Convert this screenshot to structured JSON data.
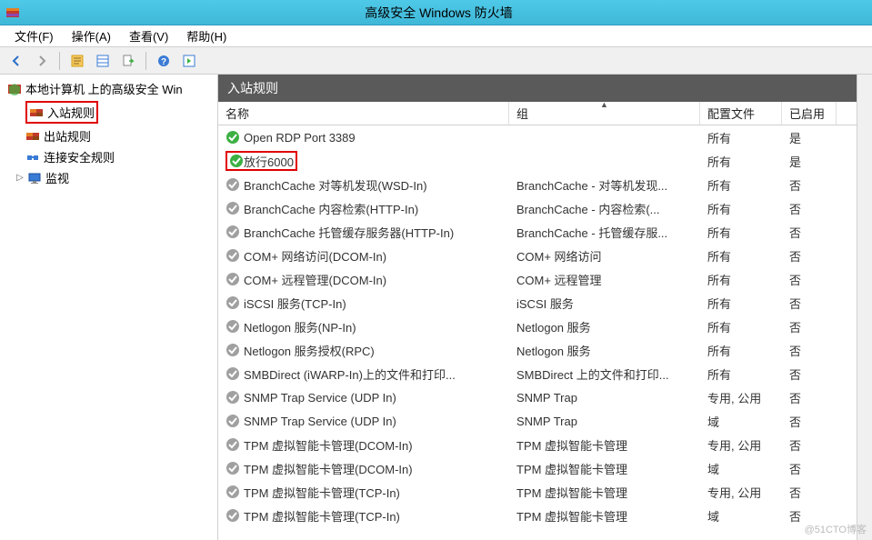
{
  "window": {
    "title": "高级安全 Windows 防火墙"
  },
  "menu": {
    "file": "文件(F)",
    "action": "操作(A)",
    "view": "查看(V)",
    "help": "帮助(H)"
  },
  "tree": {
    "root": "本地计算机 上的高级安全 Win",
    "inbound": "入站规则",
    "outbound": "出站规则",
    "connsec": "连接安全规则",
    "monitor": "监视"
  },
  "list": {
    "header": "入站规则",
    "columns": {
      "name": "名称",
      "group": "组",
      "profile": "配置文件",
      "enabled": "已启用"
    },
    "rows": [
      {
        "name": "Open RDP Port 3389",
        "group": "",
        "profile": "所有",
        "enabled": "是",
        "state": "enabled",
        "highlight": false
      },
      {
        "name": "放行6000",
        "group": "",
        "profile": "所有",
        "enabled": "是",
        "state": "enabled",
        "highlight": true
      },
      {
        "name": "BranchCache 对等机发现(WSD-In)",
        "group": "BranchCache - 对等机发现...",
        "profile": "所有",
        "enabled": "否",
        "state": "disabled",
        "highlight": false
      },
      {
        "name": "BranchCache 内容检索(HTTP-In)",
        "group": "BranchCache - 内容检索(...",
        "profile": "所有",
        "enabled": "否",
        "state": "disabled",
        "highlight": false
      },
      {
        "name": "BranchCache 托管缓存服务器(HTTP-In)",
        "group": "BranchCache - 托管缓存服...",
        "profile": "所有",
        "enabled": "否",
        "state": "disabled",
        "highlight": false
      },
      {
        "name": "COM+ 网络访问(DCOM-In)",
        "group": "COM+ 网络访问",
        "profile": "所有",
        "enabled": "否",
        "state": "disabled",
        "highlight": false
      },
      {
        "name": "COM+ 远程管理(DCOM-In)",
        "group": "COM+ 远程管理",
        "profile": "所有",
        "enabled": "否",
        "state": "disabled",
        "highlight": false
      },
      {
        "name": "iSCSI 服务(TCP-In)",
        "group": "iSCSI 服务",
        "profile": "所有",
        "enabled": "否",
        "state": "disabled",
        "highlight": false
      },
      {
        "name": "Netlogon 服务(NP-In)",
        "group": "Netlogon 服务",
        "profile": "所有",
        "enabled": "否",
        "state": "disabled",
        "highlight": false
      },
      {
        "name": "Netlogon 服务授权(RPC)",
        "group": "Netlogon 服务",
        "profile": "所有",
        "enabled": "否",
        "state": "disabled",
        "highlight": false
      },
      {
        "name": "SMBDirect (iWARP-In)上的文件和打印...",
        "group": "SMBDirect 上的文件和打印...",
        "profile": "所有",
        "enabled": "否",
        "state": "disabled",
        "highlight": false
      },
      {
        "name": "SNMP Trap Service (UDP In)",
        "group": "SNMP Trap",
        "profile": "专用, 公用",
        "enabled": "否",
        "state": "disabled",
        "highlight": false
      },
      {
        "name": "SNMP Trap Service (UDP In)",
        "group": "SNMP Trap",
        "profile": "域",
        "enabled": "否",
        "state": "disabled",
        "highlight": false
      },
      {
        "name": "TPM 虚拟智能卡管理(DCOM-In)",
        "group": "TPM 虚拟智能卡管理",
        "profile": "专用, 公用",
        "enabled": "否",
        "state": "disabled",
        "highlight": false
      },
      {
        "name": "TPM 虚拟智能卡管理(DCOM-In)",
        "group": "TPM 虚拟智能卡管理",
        "profile": "域",
        "enabled": "否",
        "state": "disabled",
        "highlight": false
      },
      {
        "name": "TPM 虚拟智能卡管理(TCP-In)",
        "group": "TPM 虚拟智能卡管理",
        "profile": "专用, 公用",
        "enabled": "否",
        "state": "disabled",
        "highlight": false
      },
      {
        "name": "TPM 虚拟智能卡管理(TCP-In)",
        "group": "TPM 虚拟智能卡管理",
        "profile": "域",
        "enabled": "否",
        "state": "disabled",
        "highlight": false
      }
    ]
  },
  "watermark": "@51CTO博客"
}
